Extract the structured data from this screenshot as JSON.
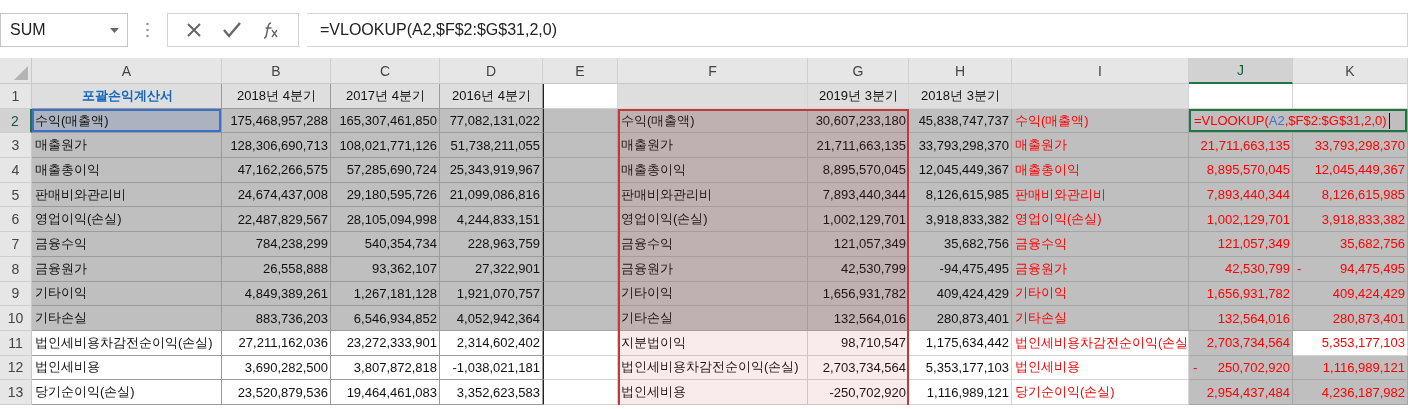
{
  "name_box": {
    "value": "SUM"
  },
  "formula_bar": {
    "value": "=VLOOKUP(A2,$F$2:$G$31,2,0)"
  },
  "columns": [
    {
      "label": "A",
      "kind": "label",
      "selected": false
    },
    {
      "label": "B",
      "kind": "number",
      "selected": false
    },
    {
      "label": "C",
      "kind": "number",
      "selected": false
    },
    {
      "label": "D",
      "kind": "number",
      "selected": false
    },
    {
      "label": "E",
      "kind": "number",
      "selected": false
    },
    {
      "label": "F",
      "kind": "label",
      "selected": false
    },
    {
      "label": "G",
      "kind": "number",
      "selected": false
    },
    {
      "label": "H",
      "kind": "number",
      "selected": false
    },
    {
      "label": "I",
      "kind": "result-label",
      "selected": false
    },
    {
      "label": "J",
      "kind": "result-number",
      "selected": true
    },
    {
      "label": "K",
      "kind": "result-number",
      "selected": false
    }
  ],
  "rows": [
    {
      "number": "1",
      "selected": false,
      "cells": [
        {
          "text": "포괄손익계산서",
          "kind": "title"
        },
        {
          "text": "2018년 4분기",
          "kind": "heading"
        },
        {
          "text": "2017년 4분기",
          "kind": "heading"
        },
        {
          "text": "2016년 4분기",
          "kind": "heading"
        },
        {
          "kind": "plain"
        },
        {
          "kind": "heading"
        },
        {
          "text": "2019년 3분기",
          "kind": "heading"
        },
        {
          "text": "2018년 3분기",
          "kind": "heading"
        },
        {
          "kind": "heading"
        },
        {
          "kind": "plain"
        },
        {
          "kind": "plain"
        }
      ]
    },
    {
      "number": "2",
      "selected": true,
      "cells": [
        {
          "text": "수익(매출액)",
          "kind": "shaded",
          "referenced": true
        },
        {
          "text": "175,468,957,288",
          "kind": "shaded"
        },
        {
          "text": "165,307,461,850",
          "kind": "shaded"
        },
        {
          "text": "77,082,131,022",
          "kind": "shaded"
        },
        {
          "kind": "shaded"
        },
        {
          "text": "수익(매출액)",
          "kind": "shaded"
        },
        {
          "text": "30,607,233,180",
          "kind": "shaded"
        },
        {
          "text": "45,838,747,737",
          "kind": "shaded"
        },
        {
          "text": "수익(매출액)",
          "kind": "shaded"
        },
        {
          "kind": "shaded",
          "selected": true,
          "parts": [
            {
              "text": "=VLOOKUP(",
              "color": "#ff0000"
            },
            {
              "text": "A2",
              "color": "#4472c4"
            },
            {
              "text": ",$F$2:$G$31,2,0)",
              "color": "#ff0000"
            }
          ]
        }
      ]
    },
    {
      "number": "3",
      "selected": false,
      "cells": [
        {
          "text": "매출원가",
          "kind": "shaded"
        },
        {
          "text": "128,306,690,713",
          "kind": "shaded"
        },
        {
          "text": "108,021,771,126",
          "kind": "shaded"
        },
        {
          "text": "51,738,211,055",
          "kind": "shaded"
        },
        {
          "kind": "shaded"
        },
        {
          "text": "매출원가",
          "kind": "shaded"
        },
        {
          "text": "21,711,663,135",
          "kind": "shaded"
        },
        {
          "text": "33,793,298,370",
          "kind": "shaded"
        },
        {
          "text": "매출원가",
          "kind": "shaded"
        },
        {
          "text": "21,711,663,135",
          "kind": "shaded"
        },
        {
          "text": "33,793,298,370",
          "kind": "shaded"
        }
      ]
    },
    {
      "number": "4",
      "selected": false,
      "cells": [
        {
          "text": "매출총이익",
          "kind": "shaded"
        },
        {
          "text": "47,162,266,575",
          "kind": "shaded"
        },
        {
          "text": "57,285,690,724",
          "kind": "shaded"
        },
        {
          "text": "25,343,919,967",
          "kind": "shaded"
        },
        {
          "kind": "shaded"
        },
        {
          "text": "매출총이익",
          "kind": "shaded"
        },
        {
          "text": "8,895,570,045",
          "kind": "shaded"
        },
        {
          "text": "12,045,449,367",
          "kind": "shaded"
        },
        {
          "text": "매출총이익",
          "kind": "shaded"
        },
        {
          "text": "8,895,570,045",
          "kind": "shaded"
        },
        {
          "text": "12,045,449,367",
          "kind": "shaded"
        }
      ]
    },
    {
      "number": "5",
      "selected": false,
      "cells": [
        {
          "text": "판매비와관리비",
          "kind": "shaded"
        },
        {
          "text": "24,674,437,008",
          "kind": "shaded"
        },
        {
          "text": "29,180,595,726",
          "kind": "shaded"
        },
        {
          "text": "21,099,086,816",
          "kind": "shaded"
        },
        {
          "kind": "shaded"
        },
        {
          "text": "판매비와관리비",
          "kind": "shaded"
        },
        {
          "text": "7,893,440,344",
          "kind": "shaded"
        },
        {
          "text": "8,126,615,985",
          "kind": "shaded"
        },
        {
          "text": "판매비와관리비",
          "kind": "shaded"
        },
        {
          "text": "7,893,440,344",
          "kind": "shaded"
        },
        {
          "text": "8,126,615,985",
          "kind": "shaded"
        }
      ]
    },
    {
      "number": "6",
      "selected": false,
      "cells": [
        {
          "text": "영업이익(손실)",
          "kind": "shaded"
        },
        {
          "text": "22,487,829,567",
          "kind": "shaded"
        },
        {
          "text": "28,105,094,998",
          "kind": "shaded"
        },
        {
          "text": "4,244,833,151",
          "kind": "shaded"
        },
        {
          "kind": "shaded"
        },
        {
          "text": "영업이익(손실)",
          "kind": "shaded"
        },
        {
          "text": "1,002,129,701",
          "kind": "shaded"
        },
        {
          "text": "3,918,833,382",
          "kind": "shaded"
        },
        {
          "text": "영업이익(손실)",
          "kind": "shaded"
        },
        {
          "text": "1,002,129,701",
          "kind": "shaded"
        },
        {
          "text": "3,918,833,382",
          "kind": "shaded"
        }
      ]
    },
    {
      "number": "7",
      "selected": false,
      "cells": [
        {
          "text": "금융수익",
          "kind": "shaded"
        },
        {
          "text": "784,238,299",
          "kind": "shaded"
        },
        {
          "text": "540,354,734",
          "kind": "shaded"
        },
        {
          "text": "228,963,759",
          "kind": "shaded"
        },
        {
          "kind": "shaded"
        },
        {
          "text": "금융수익",
          "kind": "shaded"
        },
        {
          "text": "121,057,349",
          "kind": "shaded"
        },
        {
          "text": "35,682,756",
          "kind": "shaded"
        },
        {
          "text": "금융수익",
          "kind": "shaded"
        },
        {
          "text": "121,057,349",
          "kind": "shaded"
        },
        {
          "text": "35,682,756",
          "kind": "shaded"
        }
      ]
    },
    {
      "number": "8",
      "selected": false,
      "cells": [
        {
          "text": "금융원가",
          "kind": "shaded"
        },
        {
          "text": "26,558,888",
          "kind": "shaded"
        },
        {
          "text": "93,362,107",
          "kind": "shaded"
        },
        {
          "text": "27,322,901",
          "kind": "shaded"
        },
        {
          "kind": "shaded"
        },
        {
          "text": "금융원가",
          "kind": "shaded"
        },
        {
          "text": "42,530,799",
          "kind": "shaded"
        },
        {
          "text": "-94,475,495",
          "kind": "shaded"
        },
        {
          "text": "금융원가",
          "kind": "shaded"
        },
        {
          "text": "42,530,799",
          "kind": "shaded"
        },
        {
          "text": "94,475,495",
          "sign": "-",
          "kind": "shaded"
        }
      ]
    },
    {
      "number": "9",
      "selected": false,
      "cells": [
        {
          "text": "기타이익",
          "kind": "shaded"
        },
        {
          "text": "4,849,389,261",
          "kind": "shaded"
        },
        {
          "text": "1,267,181,128",
          "kind": "shaded"
        },
        {
          "text": "1,921,070,757",
          "kind": "shaded"
        },
        {
          "kind": "shaded"
        },
        {
          "text": "기타이익",
          "kind": "shaded"
        },
        {
          "text": "1,656,931,782",
          "kind": "shaded"
        },
        {
          "text": "409,424,429",
          "kind": "shaded"
        },
        {
          "text": "기타이익",
          "kind": "shaded"
        },
        {
          "text": "1,656,931,782",
          "kind": "shaded"
        },
        {
          "text": "409,424,429",
          "kind": "shaded"
        }
      ]
    },
    {
      "number": "10",
      "selected": false,
      "cells": [
        {
          "text": "기타손실",
          "kind": "shaded"
        },
        {
          "text": "883,736,203",
          "kind": "shaded"
        },
        {
          "text": "6,546,934,852",
          "kind": "shaded"
        },
        {
          "text": "4,052,942,364",
          "kind": "shaded"
        },
        {
          "kind": "shaded"
        },
        {
          "text": "기타손실",
          "kind": "shaded"
        },
        {
          "text": "132,564,016",
          "kind": "shaded"
        },
        {
          "text": "280,873,401",
          "kind": "shaded"
        },
        {
          "text": "기타손실",
          "kind": "shaded"
        },
        {
          "text": "132,564,016",
          "kind": "shaded"
        },
        {
          "text": "280,873,401",
          "kind": "shaded"
        }
      ]
    },
    {
      "number": "11",
      "selected": false,
      "cells": [
        {
          "text": "법인세비용차감전순이익(손실)",
          "kind": "plain"
        },
        {
          "text": "27,211,162,036",
          "kind": "plain"
        },
        {
          "text": "23,272,333,901",
          "kind": "plain"
        },
        {
          "text": "2,314,602,402",
          "kind": "plain"
        },
        {
          "kind": "plain"
        },
        {
          "text": "지분법이익",
          "kind": "plain"
        },
        {
          "text": "98,710,547",
          "kind": "plain"
        },
        {
          "text": "1,175,634,442",
          "kind": "plain"
        },
        {
          "text": "법인세비용차감전순이익(손실",
          "kind": "plain"
        },
        {
          "text": "2,703,734,564",
          "kind": "shaded"
        },
        {
          "text": "5,353,177,103",
          "kind": "plain"
        }
      ]
    },
    {
      "number": "12",
      "selected": false,
      "cells": [
        {
          "text": "법인세비용",
          "kind": "plain"
        },
        {
          "text": "3,690,282,500",
          "kind": "plain"
        },
        {
          "text": "3,807,872,818",
          "kind": "plain"
        },
        {
          "text": "-1,038,021,181",
          "kind": "plain"
        },
        {
          "kind": "plain"
        },
        {
          "text": "법인세비용차감전순이익(손실)",
          "kind": "plain"
        },
        {
          "text": "2,703,734,564",
          "kind": "plain"
        },
        {
          "text": "5,353,177,103",
          "kind": "plain"
        },
        {
          "text": "법인세비용",
          "kind": "plain"
        },
        {
          "text": "250,702,920",
          "sign": "-",
          "kind": "shaded"
        },
        {
          "text": "1,116,989,121",
          "kind": "shaded"
        }
      ]
    },
    {
      "number": "13",
      "selected": false,
      "cells": [
        {
          "text": "당기순이익(손실)",
          "kind": "plain"
        },
        {
          "text": "23,520,879,536",
          "kind": "plain"
        },
        {
          "text": "19,464,461,083",
          "kind": "plain"
        },
        {
          "text": "3,352,623,583",
          "kind": "plain"
        },
        {
          "kind": "plain"
        },
        {
          "text": "법인세비용",
          "kind": "plain"
        },
        {
          "text": "-250,702,920",
          "kind": "plain"
        },
        {
          "text": "1,116,989,121",
          "kind": "plain"
        },
        {
          "text": "당기순이익(손실)",
          "kind": "plain"
        },
        {
          "text": "2,954,437,484",
          "kind": "shaded"
        },
        {
          "text": "4,236,187,982",
          "kind": "shaded"
        }
      ]
    }
  ]
}
